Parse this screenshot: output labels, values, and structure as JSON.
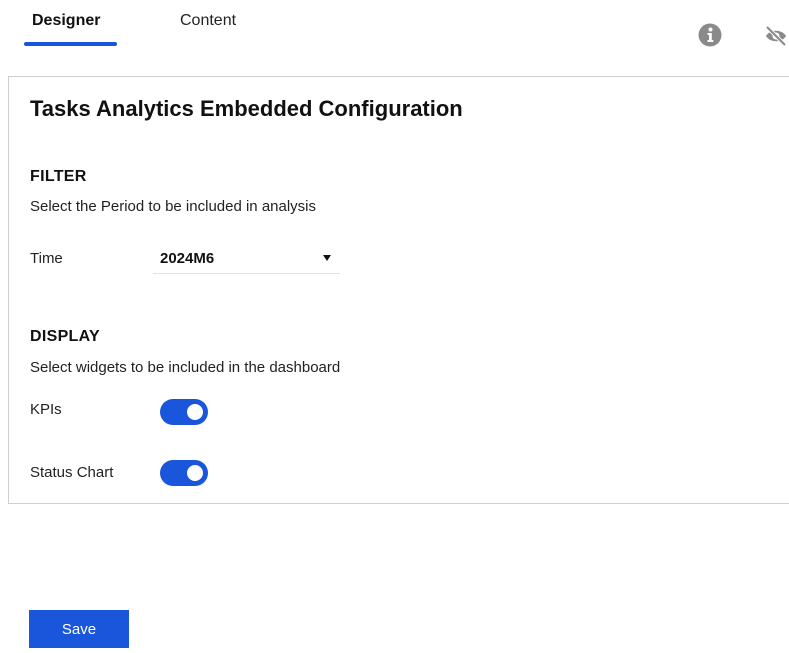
{
  "tabs": [
    {
      "label": "Designer",
      "active": true
    },
    {
      "label": "Content",
      "active": false
    }
  ],
  "header_icons": [
    "info-icon",
    "eye-off-icon"
  ],
  "panel": {
    "title": "Tasks Analytics Embedded Configuration",
    "filter": {
      "title": "FILTER",
      "description": "Select the Period to be included in analysis",
      "time_label": "Time",
      "time_value": "2024M6"
    },
    "display": {
      "title": "DISPLAY",
      "description": "Select widgets to be included in the dashboard",
      "widgets": [
        {
          "label": "KPIs",
          "enabled": true
        },
        {
          "label": "Status Chart",
          "enabled": true
        }
      ]
    }
  },
  "save_label": "Save",
  "colors": {
    "accent": "#1a56db",
    "icon_gray": "#8a8a8a",
    "border": "#cfcfcf"
  }
}
